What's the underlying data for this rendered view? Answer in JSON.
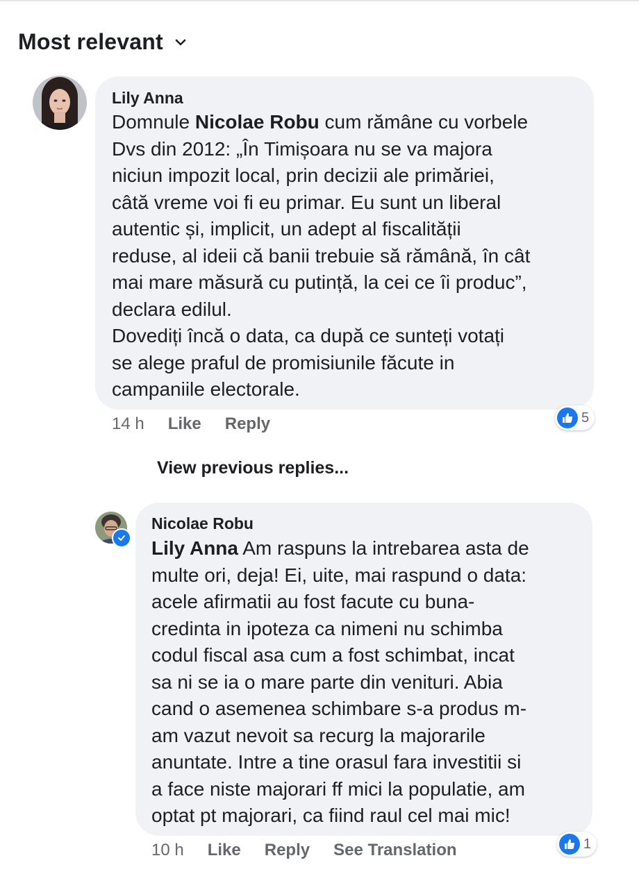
{
  "sort": {
    "label": "Most relevant",
    "icon": "chevron-down-icon"
  },
  "comment": {
    "author": "Lily Anna",
    "mention": "Nicolae Robu",
    "text_before": "Domnule ",
    "text_after": " cum rămâne cu vorbele\nDvs din 2012: „În Timișoara nu se va majora\nniciun impozit local, prin decizii ale primăriei,\ncâtă vreme voi fi eu primar. Eu sunt un liberal\nautentic și, implicit, un adept al fiscalității\nreduse, al ideii că banii trebuie să rămână, în cât\nmai mare măsură cu putință, la cei ce îi produc”,\ndeclara edilul.\nDovediți încă o data, ca după ce sunteți votați\nse alege praful de promisiunile făcute in\ncampaniile electorale.",
    "time": "14 h",
    "like_label": "Like",
    "reply_label": "Reply",
    "reaction_count": "5",
    "accent": "#1877f2"
  },
  "view_previous": "View previous replies...",
  "reply": {
    "author": "Nicolae Robu",
    "mention": "Lily Anna",
    "text_after": " Am raspuns la intrebarea asta de\nmulte ori, deja! Ei, uite, mai raspund o data:\nacele afirmatii au fost facute cu buna-\ncredinta in ipoteza ca nimeni nu schimba\ncodul fiscal asa cum a fost schimbat, incat\nsa ni se ia o mare parte din venituri. Abia\ncand o asemenea schimbare s-a produs m-\nam vazut nevoit sa recurg la majorarile\nanuntate. Intre a tine orasul fara investitii si\na face niste majorari ff mici la populatie, am\noptat pt majorari, ca fiind raul cel mai mic!",
    "time": "10 h",
    "like_label": "Like",
    "reply_label": "Reply",
    "translate_label": "See Translation",
    "reaction_count": "1"
  }
}
